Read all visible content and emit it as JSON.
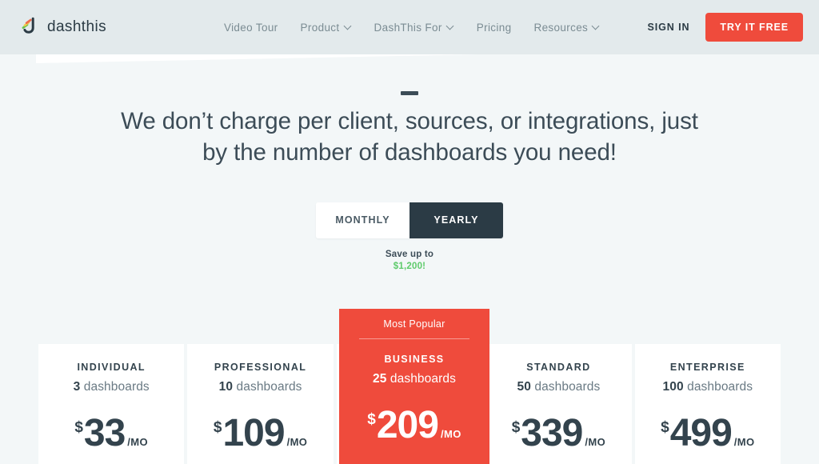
{
  "colors": {
    "header_bg": "#e3eaec",
    "page_bg": "#f3f7f8",
    "accent_red": "#ef4b3c",
    "dark": "#2b3b45",
    "green": "#5ecb6b"
  },
  "header": {
    "brand_name": "dashthis",
    "nav_items": [
      {
        "label": "Video Tour",
        "has_dropdown": false
      },
      {
        "label": "Product",
        "has_dropdown": true
      },
      {
        "label": "DashThis For",
        "has_dropdown": true
      },
      {
        "label": "Pricing",
        "has_dropdown": false
      },
      {
        "label": "Resources",
        "has_dropdown": true
      }
    ],
    "signin_label": "SIGN IN",
    "cta_label": "TRY IT FREE"
  },
  "hero": {
    "title": "We don’t charge per client, sources, or integrations, just by the number of dashboards you need!"
  },
  "billing": {
    "options": [
      {
        "label": "MONTHLY",
        "active": false
      },
      {
        "label": "YEARLY",
        "active": true
      }
    ],
    "savings_prefix": "Save up to",
    "savings_amount": "$1,200!"
  },
  "plans": [
    {
      "name": "INDIVIDUAL",
      "dashboards_count": "3",
      "dashboards_word": "dashboards",
      "currency": "$",
      "amount": "33",
      "period": "/MO",
      "featured": false
    },
    {
      "name": "PROFESSIONAL",
      "dashboards_count": "10",
      "dashboards_word": "dashboards",
      "currency": "$",
      "amount": "109",
      "period": "/MO",
      "featured": false
    },
    {
      "name": "BUSINESS",
      "dashboards_count": "25",
      "dashboards_word": "dashboards",
      "currency": "$",
      "amount": "209",
      "period": "/MO",
      "featured": true,
      "badge_label": "Most Popular"
    },
    {
      "name": "STANDARD",
      "dashboards_count": "50",
      "dashboards_word": "dashboards",
      "currency": "$",
      "amount": "339",
      "period": "/MO",
      "featured": false
    },
    {
      "name": "ENTERPRISE",
      "dashboards_count": "100",
      "dashboards_word": "dashboards",
      "currency": "$",
      "amount": "499",
      "period": "/MO",
      "featured": false
    }
  ]
}
